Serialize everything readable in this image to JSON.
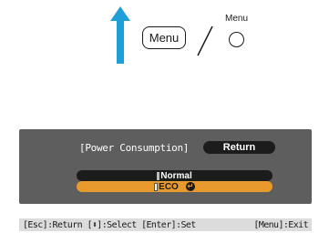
{
  "remote": {
    "menu_button_label": "Menu",
    "projector_menu_label": "Menu",
    "arrow_color": "#1e9fd8"
  },
  "dialog": {
    "title": "[Power Consumption]",
    "return_label": "Return",
    "options": [
      {
        "label": "Normal",
        "selected": false
      },
      {
        "label": "ECO",
        "selected": true
      }
    ],
    "highlight_color": "#e89a2c"
  },
  "help_bar": {
    "left_text": "[Esc]:Return [⬍]:Select [Enter]:Set",
    "right_text": "[Menu]:Exit"
  }
}
